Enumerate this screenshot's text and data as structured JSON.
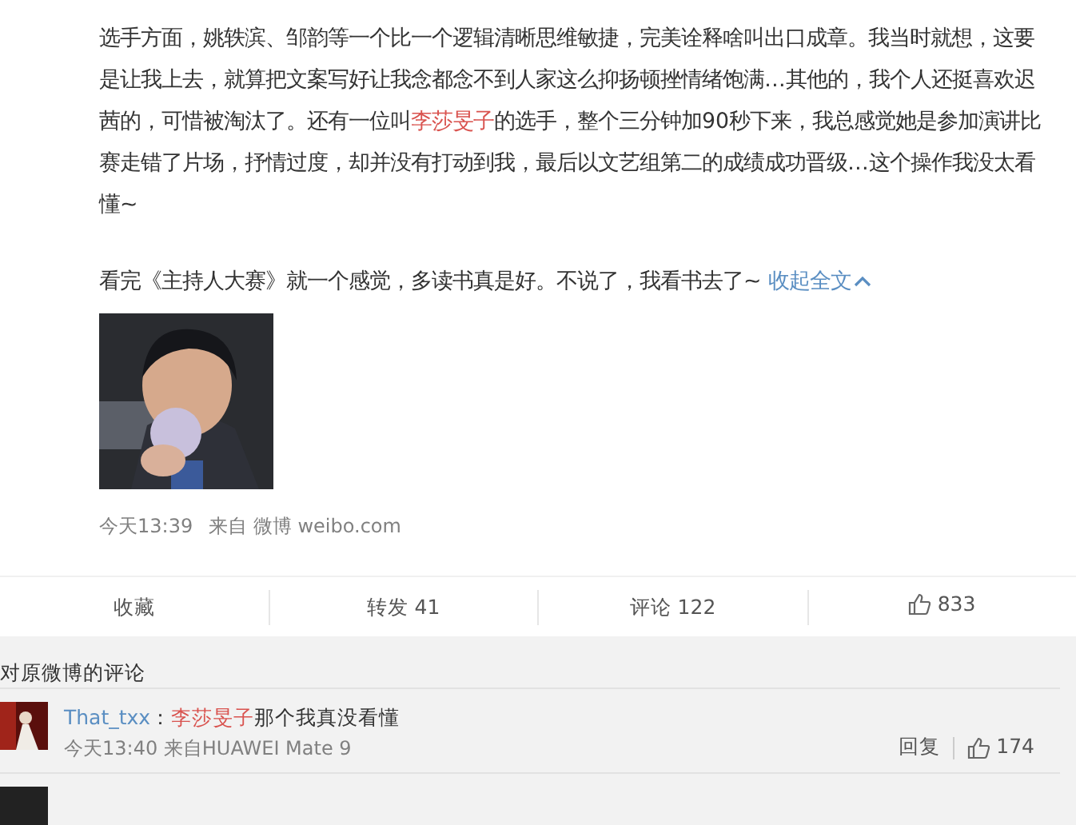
{
  "post": {
    "paragraphs": [
      [
        {
          "kind": "text",
          "text": "选手方面，姚轶滨、邹韵等一个比一个逻辑清晰思维敏捷，完美诠释啥叫出口成章。我当时就想，这要是让我上去，就算把文案写好让我念都念不到人家这么抑扬顿挫情绪饱满…其他的，我个人还挺喜欢迟茜的，可惜被淘汰了。还有一位叫"
        },
        {
          "kind": "mention",
          "text": "李莎旻子"
        },
        {
          "kind": "text",
          "text": "的选手，整个三分钟加90秒下来，我总感觉她是参加演讲比赛走错了片场，抒情过度，却并没有打动到我，最后以文艺组第二的成绩成功晋级…这个操作我没太看懂~"
        }
      ],
      [
        {
          "kind": "text",
          "text": "看完《主持人大赛》就一个感觉，多读书真是好。不说了，我看书去了~ "
        },
        {
          "kind": "link",
          "text": "收起全文"
        }
      ]
    ],
    "image": {
      "kind": "picture"
    },
    "meta": {
      "time": "今天13:39",
      "source": "来自 微博 weibo.com"
    },
    "actions": [
      {
        "kind": "text",
        "label": "收藏"
      },
      {
        "kind": "text",
        "label": "转发 41"
      },
      {
        "kind": "text",
        "label": "评论 122"
      },
      {
        "kind": "like",
        "label": "833"
      }
    ]
  },
  "comments": {
    "heading": "对原微博的评论",
    "items": [
      {
        "kind": "comment",
        "user": "That_txx",
        "separator": "：",
        "mention": "李莎旻子",
        "text": "那个我真没看懂",
        "time": "今天13:40 来自HUAWEI Mate 9",
        "reply": "回复",
        "likes": "174"
      },
      {
        "kind": "cut-off"
      }
    ]
  }
}
